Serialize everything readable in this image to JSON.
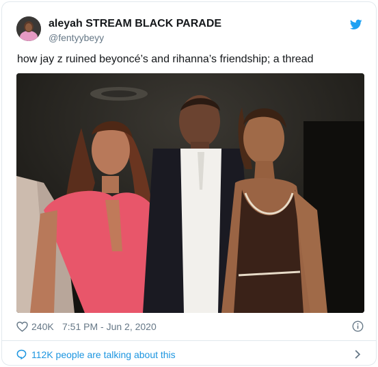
{
  "author": {
    "display_name": "aleyah STREAM BLACK PARADE",
    "handle": "@fentyybeyy"
  },
  "tweet": {
    "text": "how jay z ruined beyoncé’s and rihanna’s friendship; a thread"
  },
  "meta": {
    "likes": "240K",
    "timestamp": "7:51 PM - Jun 2, 2020"
  },
  "footer": {
    "conversation_label": "112K people are talking about this"
  },
  "colors": {
    "brand_blue": "#1da1f2",
    "link_blue": "#1b95e0",
    "muted_gray": "#657786"
  },
  "icons": {
    "brand": "twitter-bird-icon",
    "like": "heart-icon",
    "info": "info-icon",
    "conversation": "speech-bubble-icon",
    "chevron": "chevron-right-icon"
  }
}
